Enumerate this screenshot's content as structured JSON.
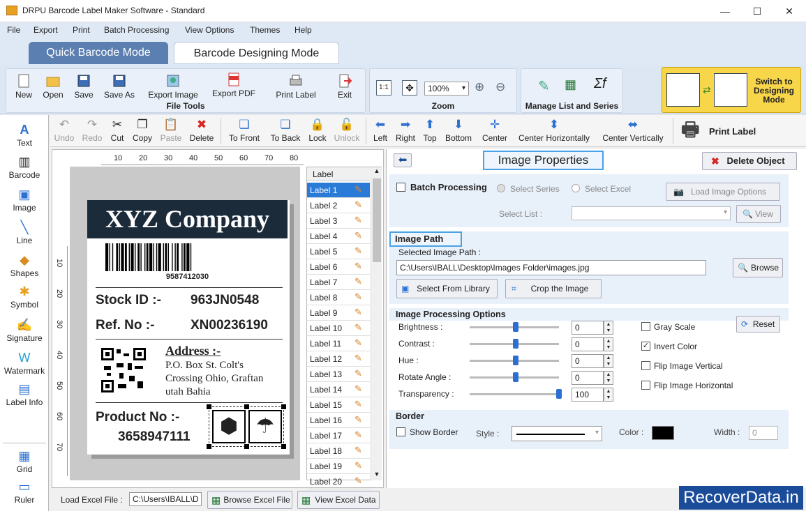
{
  "window": {
    "title": "DRPU Barcode Label Maker Software - Standard",
    "minimize": "—",
    "maximize": "☐",
    "close": "✕"
  },
  "menu": [
    "File",
    "Export",
    "Print",
    "Batch Processing",
    "View Options",
    "Themes",
    "Help"
  ],
  "mode_tabs": {
    "quick": "Quick Barcode Mode",
    "designing": "Barcode Designing Mode"
  },
  "ribbon": {
    "file_tools": {
      "label": "File Tools",
      "buttons": [
        "New",
        "Open",
        "Save",
        "Save As",
        "Export Image",
        "Export PDF",
        "Print Label",
        "Exit"
      ]
    },
    "zoom": {
      "label": "Zoom",
      "value": "100%"
    },
    "manage": {
      "label": "Manage List and Series"
    },
    "switch": {
      "line1": "Switch to",
      "line2": "Designing",
      "line3": "Mode"
    }
  },
  "toolbar": [
    "Undo",
    "Redo",
    "Cut",
    "Copy",
    "Paste",
    "Delete",
    "To Front",
    "To Back",
    "Lock",
    "Unlock",
    "Left",
    "Right",
    "Top",
    "Bottom",
    "Center",
    "Center Horizontally",
    "Center Vertically",
    "Print Label"
  ],
  "tools": [
    "Text",
    "Barcode",
    "Image",
    "Line",
    "Shapes",
    "Symbol",
    "Signature",
    "Watermark",
    "Label Info",
    "Grid",
    "Ruler"
  ],
  "ruler_top": [
    "10",
    "20",
    "30",
    "40",
    "50",
    "60",
    "70",
    "80"
  ],
  "ruler_left": [
    "10",
    "20",
    "30",
    "40",
    "50",
    "60",
    "70"
  ],
  "label": {
    "company": "XYZ Company",
    "barcode_number": "9587412030",
    "stock_label": "Stock ID :-",
    "stock_value": "963JN0548",
    "ref_label": "Ref. No :-",
    "ref_value": "XN00236190",
    "address_title": "Address :-",
    "address_lines": [
      "P.O. Box St. Colt's",
      "Crossing Ohio, Graftan",
      "utah Bahia"
    ],
    "product_label": "Product No :-",
    "product_value": "3658947111"
  },
  "label_list": {
    "header": "Label",
    "items": [
      "Label 1",
      "Label 2",
      "Label 3",
      "Label 4",
      "Label 5",
      "Label 6",
      "Label 7",
      "Label 8",
      "Label 9",
      "Label 10",
      "Label 11",
      "Label 12",
      "Label 13",
      "Label 14",
      "Label 15",
      "Label 16",
      "Label 17",
      "Label 18",
      "Label 19",
      "Label 20"
    ]
  },
  "bottom": {
    "load_excel_label": "Load Excel File :",
    "excel_path": "C:\\Users\\IBALL\\D",
    "browse_excel": "Browse Excel File",
    "view_excel": "View Excel Data"
  },
  "props": {
    "title": "Image Properties",
    "delete_object": "Delete Object",
    "batch_processing": "Batch Processing",
    "select_series": "Select Series",
    "select_excel": "Select Excel",
    "load_image_options": "Load Image Options",
    "select_list": "Select List :",
    "view": "View",
    "image_path_title": "Image Path",
    "selected_image_path": "Selected Image Path :",
    "image_path_value": "C:\\Users\\IBALL\\Desktop\\Images Folder\\images.jpg",
    "browse": "Browse",
    "select_from_library": "Select From Library",
    "crop_image": "Crop the Image",
    "processing_title": "Image Processing Options",
    "sliders": [
      {
        "label": "Brightness :",
        "value": "0",
        "level": 0.5
      },
      {
        "label": "Contrast :",
        "value": "0",
        "level": 0.5
      },
      {
        "label": "Hue :",
        "value": "0",
        "level": 0.5
      },
      {
        "label": "Rotate Angle :",
        "value": "0",
        "level": 0.5
      },
      {
        "label": "Transparency :",
        "value": "100",
        "level": 1.0
      }
    ],
    "reset": "Reset",
    "gray_scale": "Gray Scale",
    "invert_color": "Invert Color",
    "flip_vertical": "Flip Image Vertical",
    "flip_horizontal": "Flip Image Horizontal",
    "border_title": "Border",
    "show_border": "Show Border",
    "style": "Style :",
    "color": "Color :",
    "width": "Width :",
    "width_value": "0"
  },
  "watermark": "RecoverData.in"
}
